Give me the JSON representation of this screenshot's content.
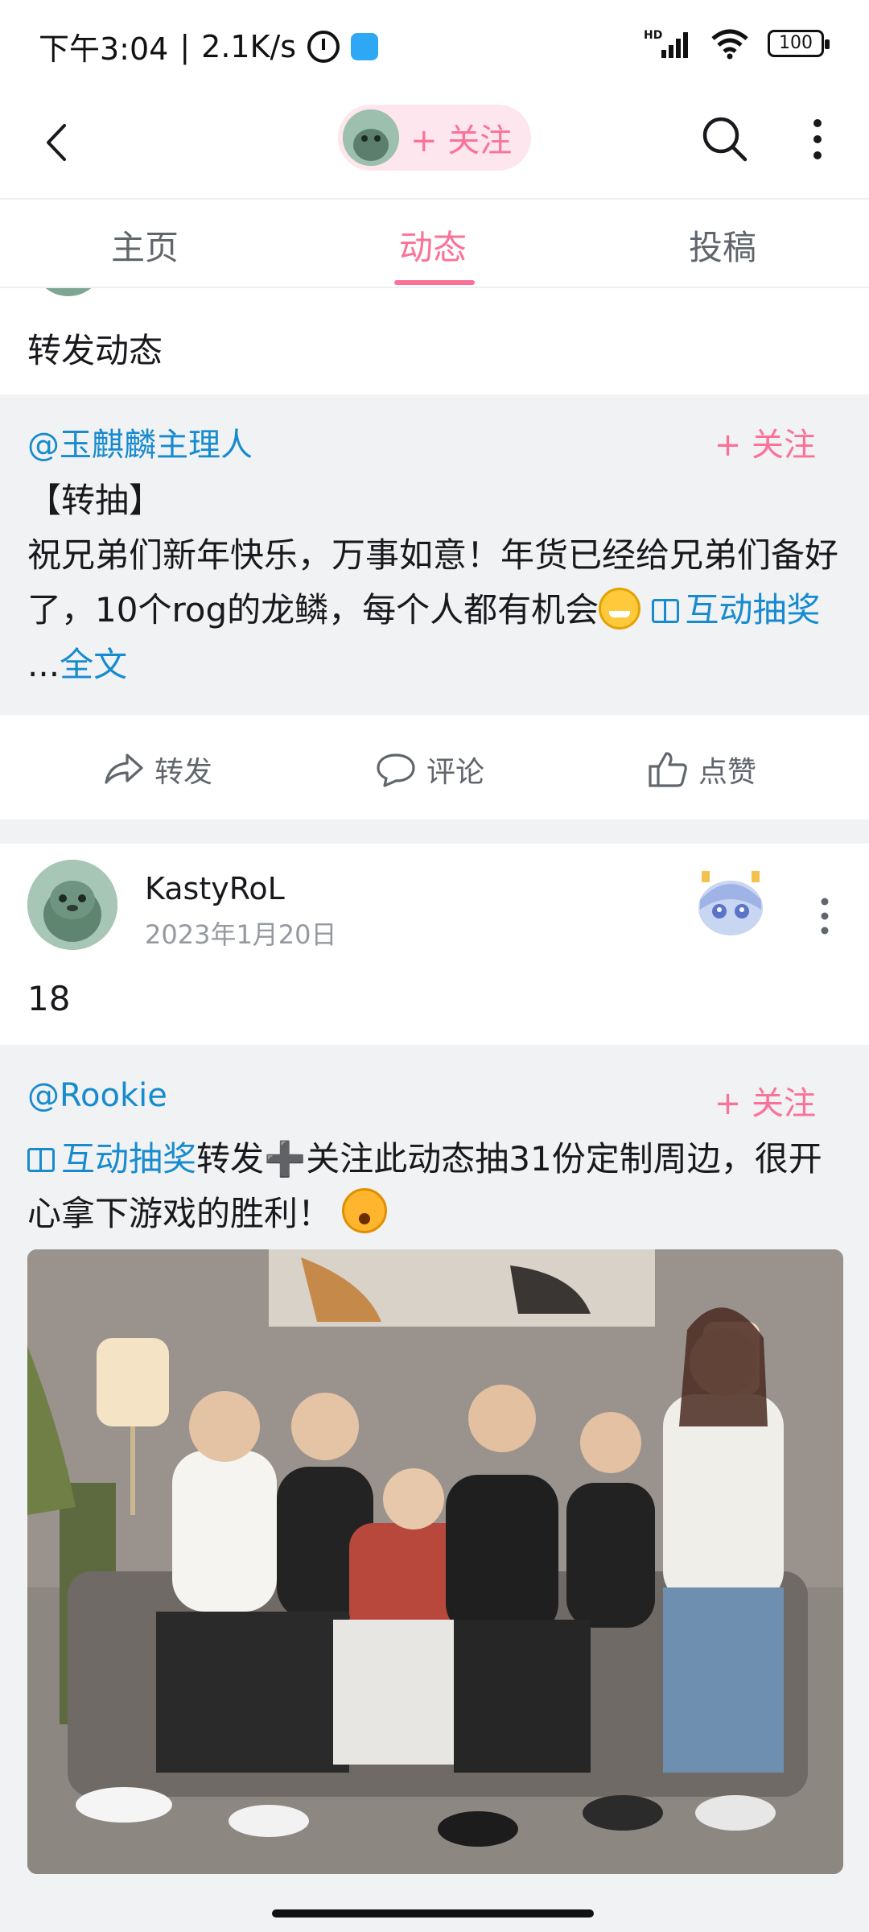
{
  "status_bar": {
    "time": "下午3:04",
    "speed": "2.1K/s",
    "network": "HD",
    "battery": "100"
  },
  "nav": {
    "follow_label": "+ 关注"
  },
  "tabs": {
    "home": "主页",
    "dynamic": "动态",
    "submit": "投稿",
    "active": "动态"
  },
  "post1": {
    "text": "转发动态",
    "repost": {
      "author": "@玉麒麟主理人",
      "follow": "+ 关注",
      "line1": "【转抽】",
      "line2": "祝兄弟们新年快乐，万事如意！年货已经给兄弟们备好了，10个rog的龙鳞，每个人都有机会",
      "lottery_link": "互动抽奖",
      "more_link": "全文"
    },
    "actions": {
      "forward": "转发",
      "comment": "评论",
      "like": "点赞"
    }
  },
  "post2": {
    "username": "KastyRoL",
    "date": "2023年1月20日",
    "text": "18",
    "repost": {
      "author": "@Rookie",
      "follow": "+ 关注",
      "lottery_link": "互动抽奖",
      "body": "转发➕关注此动态抽31份定制周边，很开心拿下游戏的胜利！"
    }
  },
  "colors": {
    "accent_pink": "#fb7299",
    "link_blue": "#178bcf",
    "muted_gray": "#61666d",
    "bg_gray": "#f1f2f3"
  }
}
